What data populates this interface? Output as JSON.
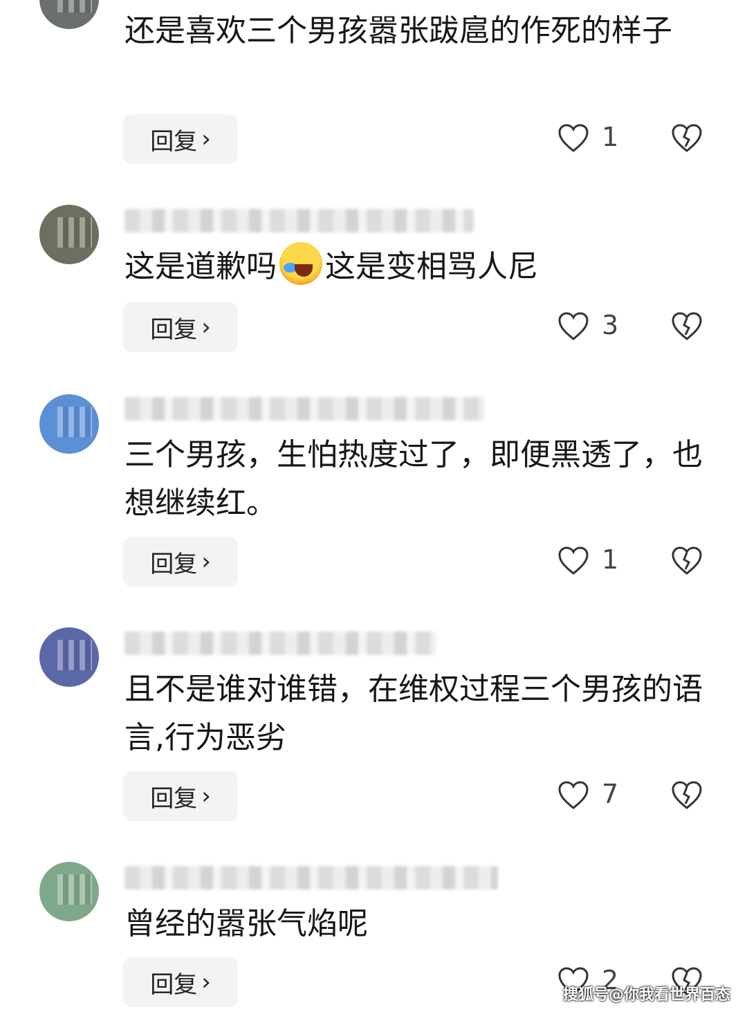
{
  "reply_label": "回复",
  "reply_chevron": "›",
  "icons": {
    "like": "heart-icon",
    "dislike": "broken-heart-icon",
    "reply_arrow": "chevron-right-icon"
  },
  "colors": {
    "reply_bg": "#f3f3f3",
    "text": "#161616",
    "icon": "#333333"
  },
  "comments": [
    {
      "text": "还是喜欢三个男孩嚣张跋扈的作死的样子",
      "likes": "1",
      "avatar_color": "#6b6f70"
    },
    {
      "text_before": "这是道歉吗",
      "emoji": "laughing-crying-emoji",
      "text_after": "这是变相骂人尼",
      "likes": "3",
      "avatar_color": "#6d7060"
    },
    {
      "text": "三个男孩，生怕热度过了，即便黑透了，也想继续红。",
      "likes": "1",
      "avatar_color": "#5b8fd6"
    },
    {
      "text": "且不是谁对谁错，在维权过程三个男孩的语言,行为恶劣",
      "likes": "7",
      "avatar_color": "#5a68a8"
    },
    {
      "text": "曾经的嚣张气焰呢",
      "likes": "2",
      "avatar_color": "#7fa88a"
    }
  ],
  "watermark": "搜狐号@你我看世界百态"
}
